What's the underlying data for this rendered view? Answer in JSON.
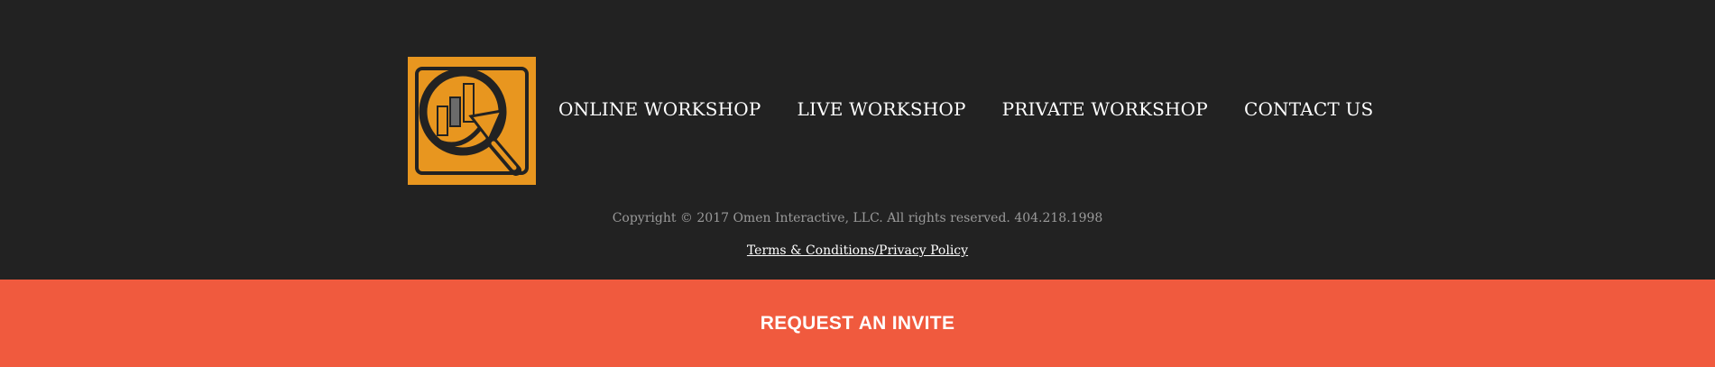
{
  "colors": {
    "background": "#222222",
    "logo_orange": "#e8961f",
    "cta_background": "#f05a3e",
    "text_primary": "#ffffff",
    "text_muted": "#9a9a9a"
  },
  "logo": {
    "icon": "magnifying-glass-chart-icon"
  },
  "nav": {
    "items": [
      {
        "label": "ONLINE WORKSHOP"
      },
      {
        "label": "LIVE WORKSHOP"
      },
      {
        "label": "PRIVATE WORKSHOP"
      },
      {
        "label": "CONTACT US"
      }
    ]
  },
  "footer": {
    "copyright": "Copyright © 2017 Omen Interactive, LLC. All rights reserved. 404.218.1998",
    "terms_link": "Terms & Conditions/Privacy Policy"
  },
  "cta": {
    "label": "REQUEST AN INVITE"
  }
}
